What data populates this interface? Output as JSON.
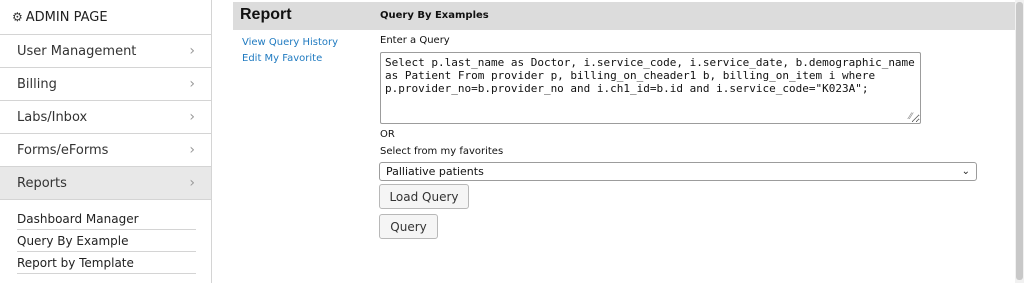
{
  "sidebar": {
    "header": "ADMIN PAGE",
    "items": [
      {
        "label": "User Management"
      },
      {
        "label": "Billing"
      },
      {
        "label": "Labs/Inbox"
      },
      {
        "label": "Forms/eForms"
      },
      {
        "label": "Reports"
      }
    ],
    "subitems": [
      {
        "label": "Dashboard Manager"
      },
      {
        "label": "Query By Example"
      },
      {
        "label": "Report by Template"
      }
    ]
  },
  "main": {
    "title": "Report",
    "heading": "Query By Examples",
    "links": [
      "View Query History",
      "Edit My Favorite"
    ],
    "enter_query_label": "Enter a Query",
    "query_text": "Select p.last_name as Doctor, i.service_code, i.service_date, b.demographic_name as Patient From provider p, billing_on_cheader1 b, billing_on_item i where p.provider_no=b.provider_no and i.ch1_id=b.id and i.service_code=\"K023A\";",
    "or_label": "OR",
    "favorites_label": "Select from my favorites",
    "favorite_selected": "Palliative patients",
    "load_button": "Load Query",
    "query_button": "Query"
  },
  "icons": {
    "header": "gear-icon",
    "nav": "chevron-right-icon",
    "select": "chevron-down-icon"
  }
}
